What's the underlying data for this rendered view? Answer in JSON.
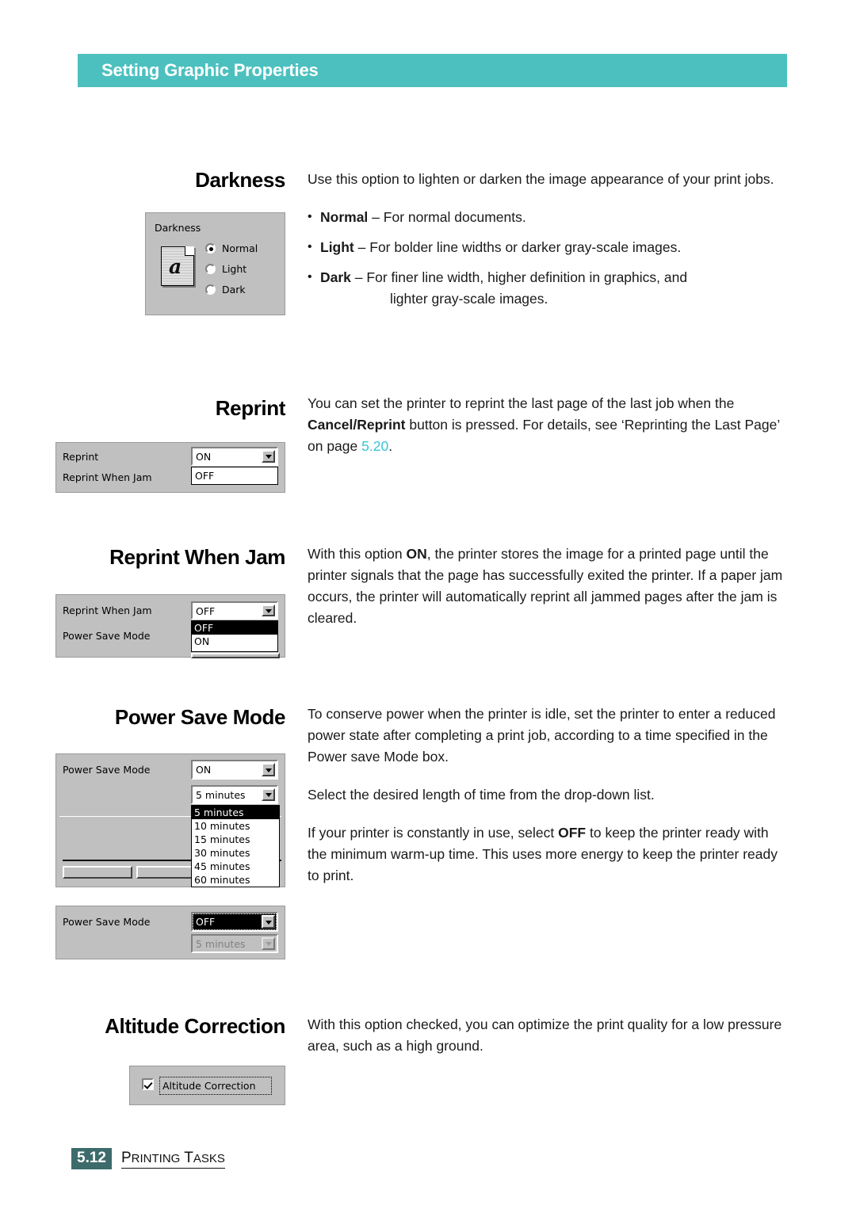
{
  "header": {
    "title": "Setting Graphic Properties",
    "band_color": "#4cc0bf"
  },
  "sections": [
    {
      "heading": "Darkness",
      "paragraphs": [
        "Use this option to lighten or darken the image appearance of your print jobs."
      ],
      "bullets": [
        {
          "term": "Normal",
          "dash": "–",
          "text": "For normal documents.",
          "cont": ""
        },
        {
          "term": "Light",
          "dash": "–",
          "text": "For bolder line widths or darker gray-scale images.",
          "cont": ""
        },
        {
          "term": "Dark",
          "dash": "–",
          "text": "For finer line width, higher definition in graphics, and",
          "cont": "lighter gray-scale images."
        }
      ],
      "dialog": {
        "group_label": "Darkness",
        "icon": "document-a-icon",
        "radios": [
          {
            "label": "Normal",
            "accel": "N",
            "checked": true
          },
          {
            "label": "Light",
            "accel": "L",
            "checked": false
          },
          {
            "label": "Dark",
            "accel": "k",
            "checked": false
          }
        ]
      }
    },
    {
      "heading": "Reprint",
      "body_runs": [
        {
          "t": "You can set the printer to reprint the last page of the last job when the ",
          "b": false
        },
        {
          "t": "Cancel/Reprint",
          "b": true
        },
        {
          "t": " button is pressed. For details, see ‘Reprinting the Last Page’ on page ",
          "b": false
        },
        {
          "t": "5.20",
          "b": false,
          "ref": true
        },
        {
          "t": ".",
          "b": false
        }
      ],
      "dialog": {
        "rows": [
          {
            "label": "Reprint",
            "accel_index": 4,
            "label_plain": "Reprint"
          },
          {
            "label": "Reprint When Jam",
            "accel_index": 12,
            "label_plain": "Reprint When Jam"
          }
        ],
        "combo_value": "ON",
        "second_value": "OFF"
      }
    },
    {
      "heading": "Reprint When Jam",
      "body_runs": [
        {
          "t": "With this option ",
          "b": false
        },
        {
          "t": "ON",
          "b": true
        },
        {
          "t": ", the printer stores the image for a printed page until the printer signals that the page has successfully exited the printer. If a paper jam occurs, the printer will automatically reprint all jammed pages after the jam is cleared.",
          "b": false
        }
      ],
      "dialog": {
        "row1_label": "Reprint When Jam",
        "row2_label": "Power Save Mode",
        "combo_value": "OFF",
        "open_items": [
          {
            "label": "OFF",
            "highlighted": true
          },
          {
            "label": "ON",
            "highlighted": false
          }
        ]
      }
    },
    {
      "heading": "Power Save Mode",
      "paragraphs": [
        "To conserve power when the printer is idle, set the printer to enter a reduced power state after completing a print job, according to a time specified in the Power save Mode box.",
        "Select the desired length of time from the drop-down list."
      ],
      "body_runs_last": [
        {
          "t": "If your printer is constantly in use, select ",
          "b": false
        },
        {
          "t": "OFF",
          "b": true
        },
        {
          "t": " to keep the printer ready with the minimum warm-up time. This uses more energy to keep the printer ready to print.",
          "b": false
        }
      ],
      "dialog_on": {
        "row_label": "Power Save Mode",
        "mode_value": "ON",
        "time_value": "5 minutes",
        "open_items": [
          {
            "label": "5 minutes",
            "highlighted": true
          },
          {
            "label": "10 minutes",
            "highlighted": false
          },
          {
            "label": "15 minutes",
            "highlighted": false
          },
          {
            "label": "30 minutes",
            "highlighted": false
          },
          {
            "label": "45 minutes",
            "highlighted": false
          },
          {
            "label": "60 minutes",
            "highlighted": false
          }
        ]
      },
      "dialog_off": {
        "row_label": "Power Save Mode",
        "mode_value": "OFF",
        "time_value": "5 minutes",
        "time_disabled": true
      }
    },
    {
      "heading": "Altitude Correction",
      "paragraphs": [
        "With this option checked, you can optimize the print quality for a low pressure area, such as a high ground."
      ],
      "dialog": {
        "checkbox_label": "Altitude Correction",
        "checked": true
      }
    }
  ],
  "footer": {
    "page_number": "5.12",
    "section": "PRINTING TASKS",
    "badge_color": "#3d6b6b"
  }
}
